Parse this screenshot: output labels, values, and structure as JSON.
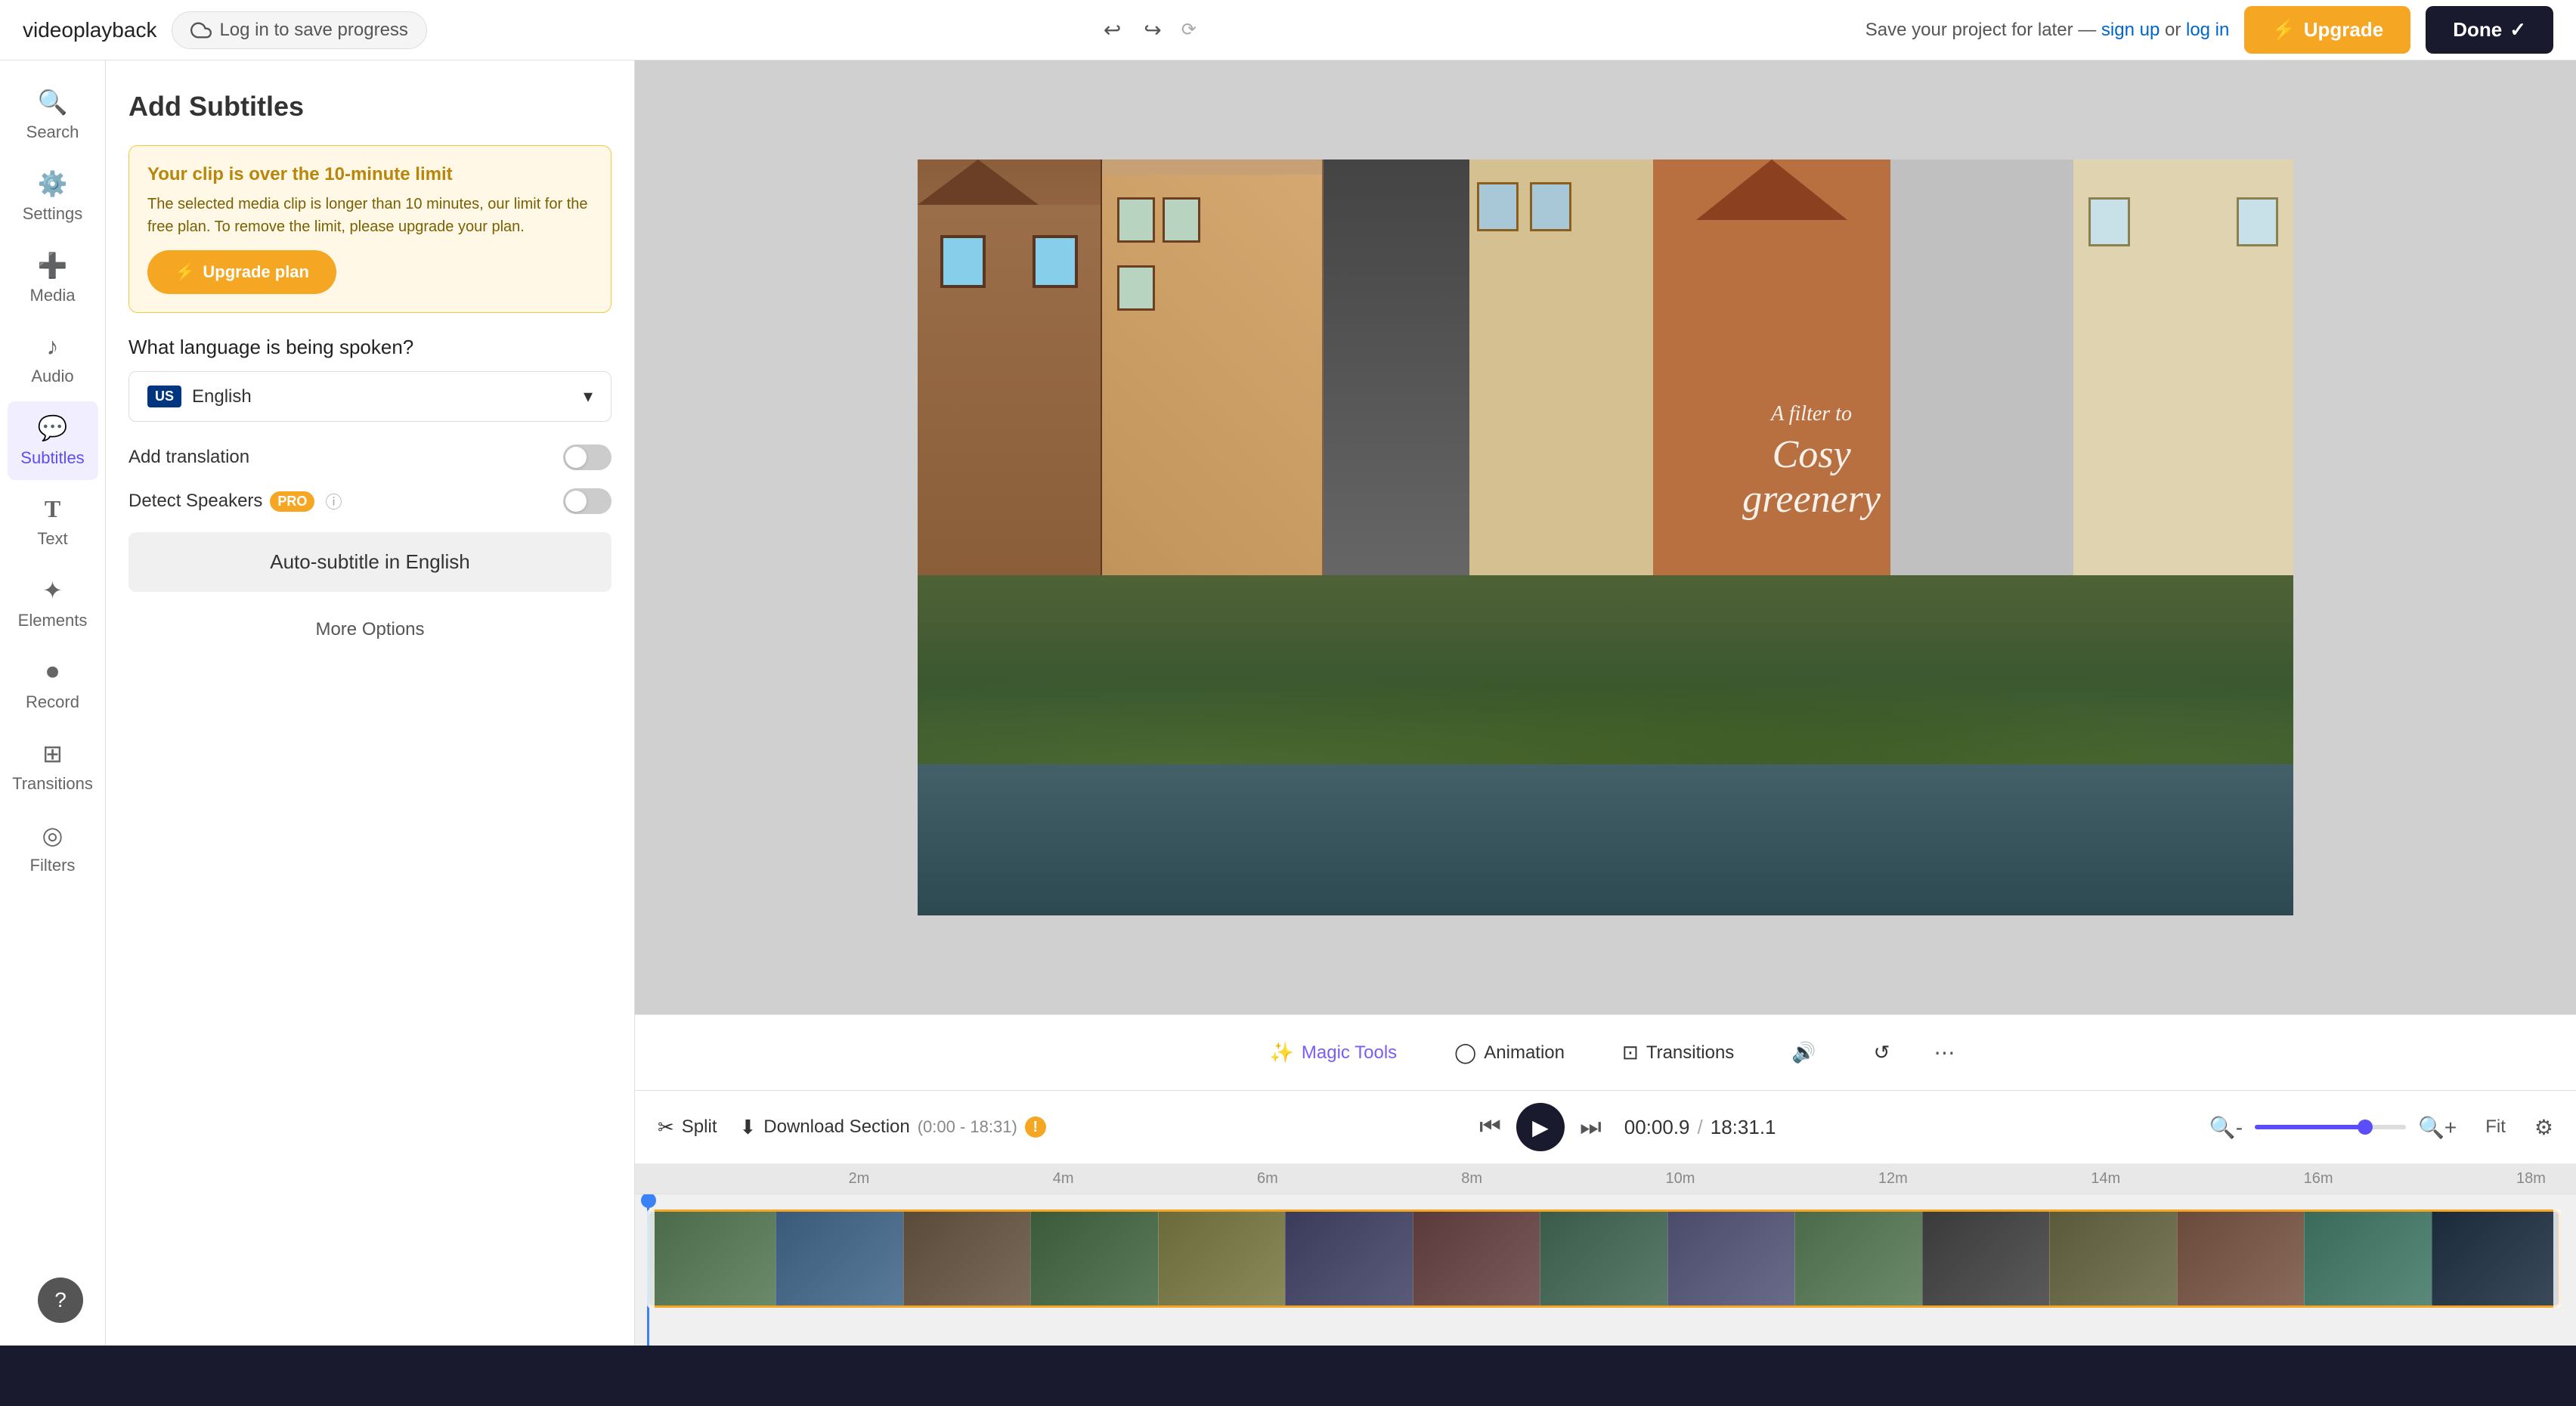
{
  "topbar": {
    "project_name": "videoplayback",
    "save_label": "Log in to save progress",
    "save_info": "Save your project for later —",
    "sign_up_label": "sign up",
    "or_label": "or",
    "log_in_label": "log in",
    "upgrade_label": "Upgrade",
    "done_label": "Done"
  },
  "sidebar": {
    "items": [
      {
        "id": "search",
        "label": "Search",
        "icon": "🔍"
      },
      {
        "id": "settings",
        "label": "Settings",
        "icon": "⚙️"
      },
      {
        "id": "media",
        "label": "Media",
        "icon": "➕"
      },
      {
        "id": "audio",
        "label": "Audio",
        "icon": "🎵"
      },
      {
        "id": "subtitles",
        "label": "Subtitles",
        "icon": "💬",
        "active": true
      },
      {
        "id": "text",
        "label": "Text",
        "icon": "T"
      },
      {
        "id": "elements",
        "label": "Elements",
        "icon": "✦"
      },
      {
        "id": "record",
        "label": "Record",
        "icon": "⏺"
      },
      {
        "id": "transitions",
        "label": "Transitions",
        "icon": "⊞"
      },
      {
        "id": "filters",
        "label": "Filters",
        "icon": "◎"
      }
    ]
  },
  "panel": {
    "title": "Add Subtitles",
    "warning": {
      "title": "Your clip is over the 10-minute limit",
      "text": "The selected media clip is longer than 10 minutes, our limit for the free plan. To remove the limit, please upgrade your plan.",
      "upgrade_btn": "Upgrade plan"
    },
    "language_label": "What language is being spoken?",
    "language": {
      "flag": "US",
      "name": "English"
    },
    "add_translation": {
      "label": "Add translation",
      "enabled": false
    },
    "detect_speakers": {
      "label": "Detect Speakers",
      "pro": true,
      "info": "ℹ",
      "enabled": false
    },
    "auto_subtitle_btn": "Auto-subtitle in English",
    "more_options_btn": "More Options"
  },
  "video": {
    "overlay_small": "A filter to",
    "overlay_large": "Cosy\ngreenery"
  },
  "toolbar": {
    "magic_tools": "Magic Tools",
    "animation": "Animation",
    "transitions": "Transitions"
  },
  "timeline": {
    "split_label": "Split",
    "download_label": "Download Section",
    "download_range": "(0:00 - 18:31)",
    "current_time": "00:00.9",
    "total_time": "18:31.1",
    "zoom_fit": "Fit",
    "ruler_marks": [
      "2m",
      "4m",
      "6m",
      "8m",
      "10m",
      "12m",
      "14m",
      "16m",
      "18m"
    ]
  }
}
